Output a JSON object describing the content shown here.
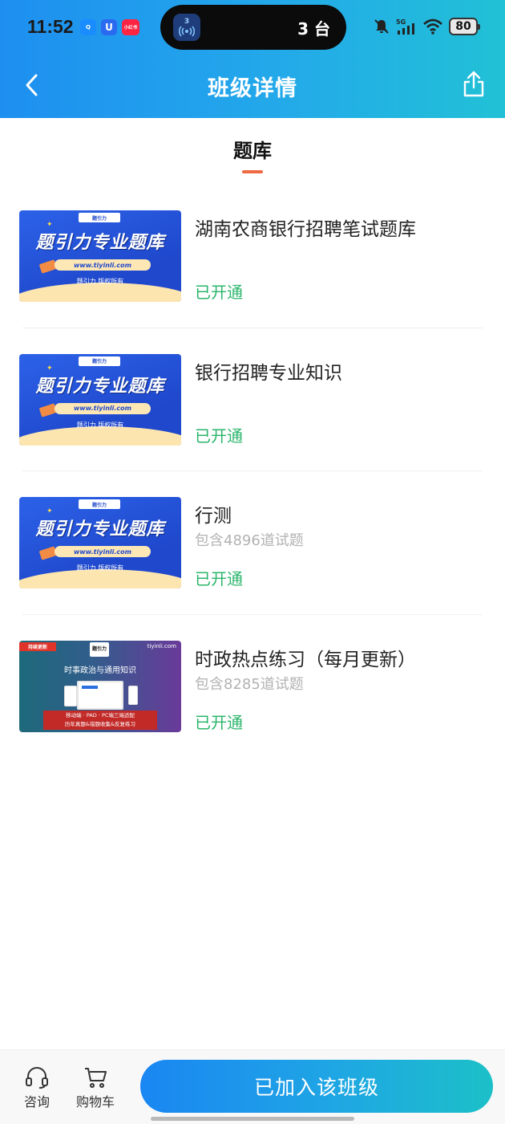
{
  "status_bar": {
    "time": "11:52",
    "app_badges": {
      "qq": "Q",
      "u": "U",
      "xhs": "小红书"
    },
    "island": {
      "badge": "3",
      "count": "3 台"
    },
    "network": "5G",
    "battery": "80"
  },
  "nav": {
    "title": "班级详情",
    "back_icon": "chevron-left-icon",
    "share_icon": "share-icon"
  },
  "tab": {
    "label": "题库",
    "accent": "#ef6a43"
  },
  "thumbnail_blue": {
    "brand": "题引力",
    "title": "题引力专业题库",
    "url": "www.tiyinli.com",
    "copyright": "题引力 版权所有"
  },
  "thumbnail_purple": {
    "ribbon": "持续更新",
    "logo": "题引力",
    "site": "tiyinli.com",
    "subtitle": "时事政治与通用知识",
    "features_line1": "移动端 · PAD · PC端三端适配",
    "features_line2": "历年真题&错题收集&反复练习"
  },
  "items": [
    {
      "title": "湖南农商银行招聘笔试题库",
      "subtitle": "",
      "status": "已开通"
    },
    {
      "title": "银行招聘专业知识",
      "subtitle": "",
      "status": "已开通"
    },
    {
      "title": "行测",
      "subtitle": "包含4896道试题",
      "status": "已开通"
    },
    {
      "title": "时政热点练习（每月更新）",
      "subtitle": "包含8285道试题",
      "status": "已开通"
    }
  ],
  "colors": {
    "status_green": "#2ab56b",
    "header_blue": "#1e8ff0",
    "header_teal": "#22c1d6"
  },
  "bottom": {
    "consult_label": "咨询",
    "cart_label": "购物车",
    "join_label": "已加入该班级"
  }
}
